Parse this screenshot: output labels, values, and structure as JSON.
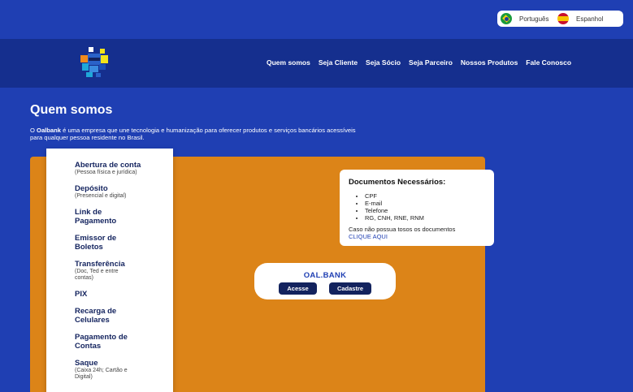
{
  "languages": [
    {
      "label": "Português",
      "flag": "brazil-flag-icon"
    },
    {
      "label": "Espanhol",
      "flag": "spain-flag-icon"
    }
  ],
  "nav": {
    "links": [
      "Quem somos",
      "Seja Cliente",
      "Seja Sócio",
      "Seja Parceiro",
      "Nossos Produtos",
      "Fale Conosco"
    ]
  },
  "page": {
    "title": "Quem somos",
    "intro_prefix": "O ",
    "intro_brand": "Oalbank",
    "intro_line1": " é uma empresa que une tecnologia e humanização para oferecer produtos e serviços bancários acessíveis",
    "intro_line2": "para qualquer pessoa residente no Brasil."
  },
  "services": [
    {
      "title": "Abertura de conta",
      "subtitle": "(Pessoa física e jurídica)"
    },
    {
      "title": "Depósito",
      "subtitle": "(Presencial e digital)"
    },
    {
      "title": "Link de Pagamento",
      "subtitle": ""
    },
    {
      "title": "Emissor de Boletos",
      "subtitle": ""
    },
    {
      "title": "Transferência",
      "subtitle": "(Doc, Ted e entre contas)"
    },
    {
      "title": "PIX",
      "subtitle": ""
    },
    {
      "title": "Recarga de Celulares",
      "subtitle": ""
    },
    {
      "title": "Pagamento de Contas",
      "subtitle": ""
    },
    {
      "title": "Saque",
      "subtitle": "(Caixa 24h; Cartão e Digital)"
    }
  ],
  "documents": {
    "title": "Documentos Necessários:",
    "items": [
      "CPF",
      "E-mail",
      "Telefone",
      "RG, CNH, RNE, RNM"
    ],
    "note": "Caso não possua tosos os documentos",
    "link": "CLIQUE AQUI"
  },
  "oal_card": {
    "title": "OAL.BANK",
    "acesse": "Acesse",
    "cadastre": "Cadastre"
  },
  "colors": {
    "background": "#1f3fb3",
    "navbar": "#152f8e",
    "panel": "#dc8418",
    "button": "#13235e"
  }
}
